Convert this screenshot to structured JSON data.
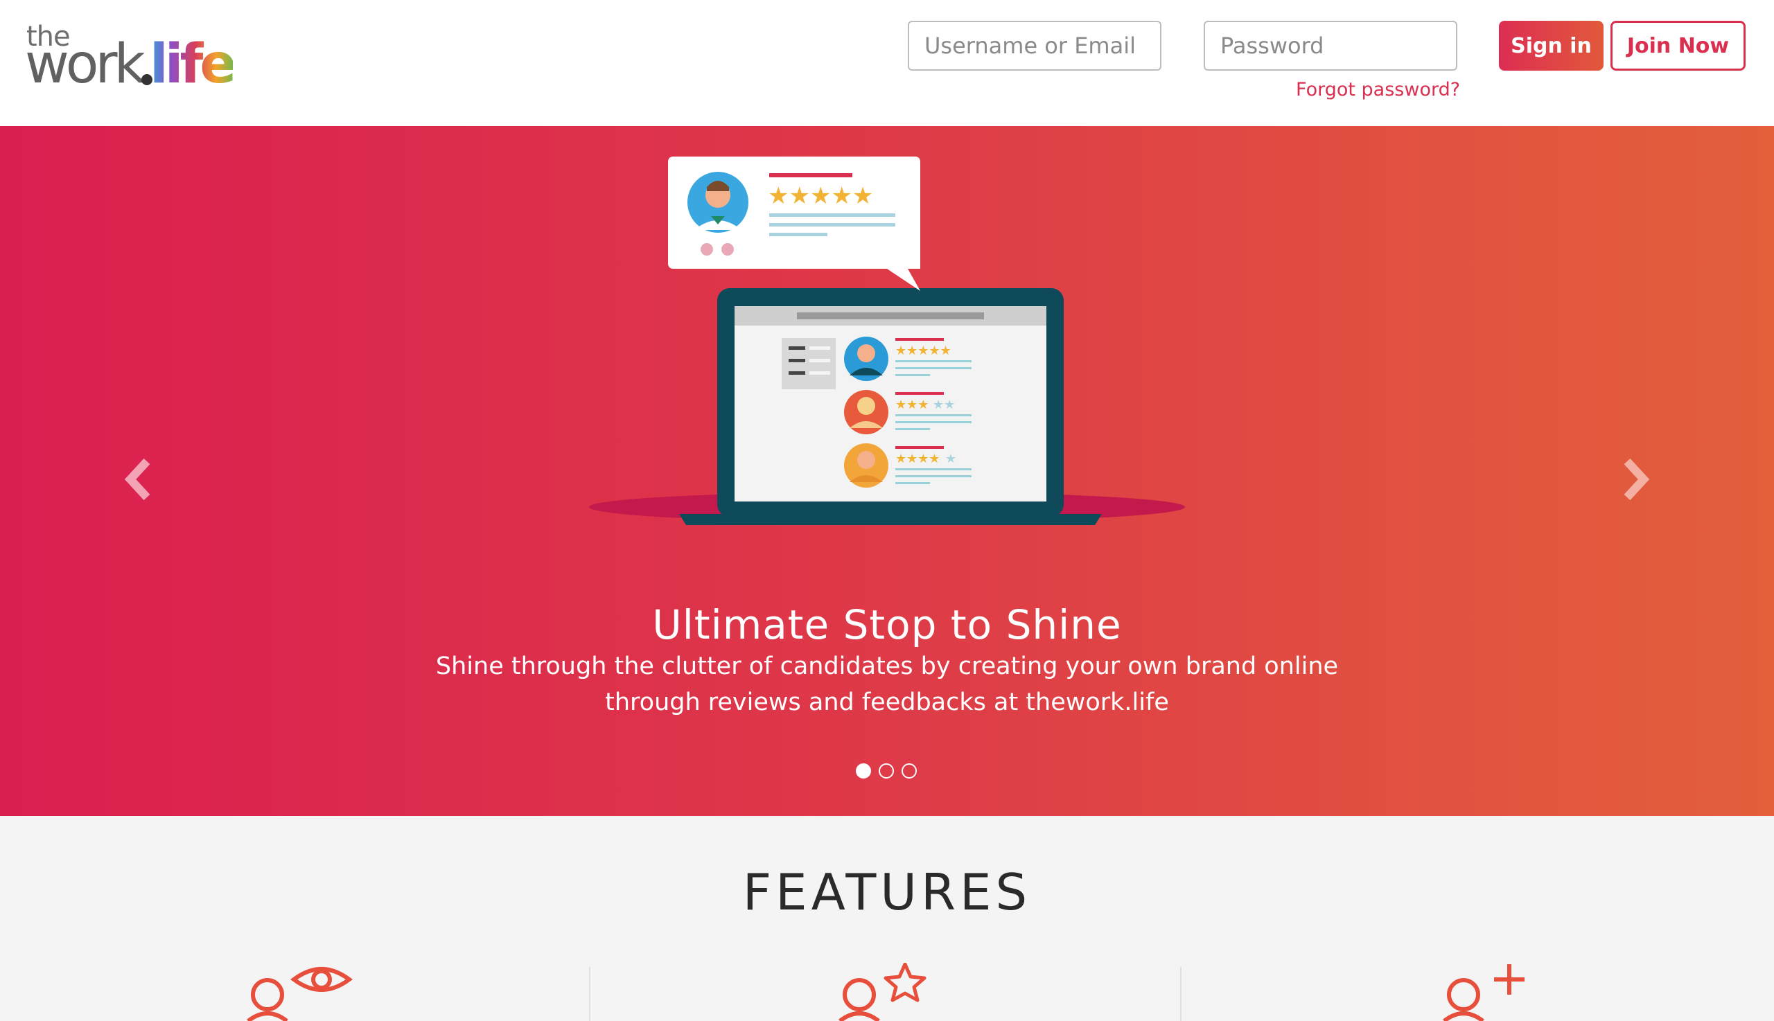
{
  "header": {
    "logo": {
      "prefix": "the",
      "main": "work",
      "suffix": "life",
      "dot": "."
    },
    "username_placeholder": "Username or Email",
    "password_placeholder": "Password",
    "forgot_label": "Forgot password?",
    "signin_label": "Sign in",
    "join_label": "Join Now"
  },
  "hero": {
    "title": "Ultimate Stop to Shine",
    "subtitle": "Shine through the clutter of candidates by creating your own brand online through reviews and feedbacks at thework.life",
    "slide_count": 3,
    "active_slide": 1,
    "colors": {
      "start": "#db1e50",
      "end": "#e3603b"
    }
  },
  "features": {
    "title": "FEATURES",
    "icons": [
      "user-eye-icon",
      "user-star-icon",
      "user-plus-icon"
    ]
  },
  "colors": {
    "accent": "#d9304f",
    "icon": "#e84e3c"
  }
}
